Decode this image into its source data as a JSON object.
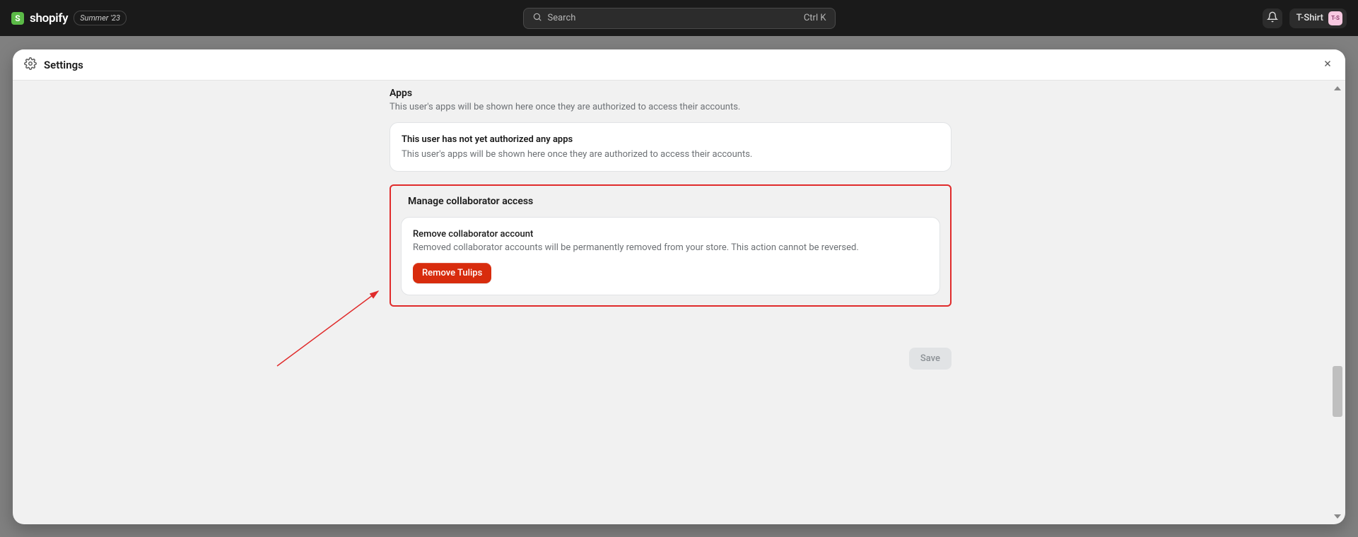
{
  "topbar": {
    "logo_initial": "S",
    "logo_text": "shopify",
    "summer_badge": "Summer '23",
    "search_placeholder": "Search",
    "search_shortcut": "Ctrl K",
    "store_name": "T-Shirt",
    "store_avatar": "T-S"
  },
  "settings": {
    "title": "Settings"
  },
  "apps": {
    "heading": "Apps",
    "subtext": "This user's apps will be shown here once they are authorized to access their accounts.",
    "card_title": "This user has not yet authorized any apps",
    "card_text": "This user's apps will be shown here once they are authorized to access their accounts."
  },
  "collaborator": {
    "heading": "Manage collaborator access",
    "remove_title": "Remove collaborator account",
    "remove_subtext": "Removed collaborator accounts will be permanently removed from your store. This action cannot be reversed.",
    "remove_button": "Remove Tulips"
  },
  "footer": {
    "save_button": "Save"
  }
}
